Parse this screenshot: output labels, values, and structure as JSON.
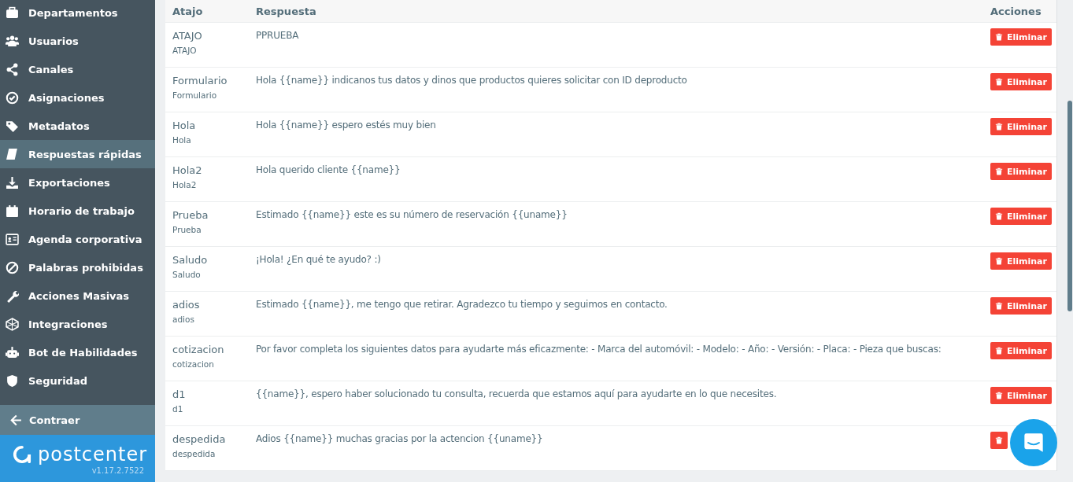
{
  "sidebar": {
    "items": [
      {
        "label": "Departamentos",
        "selected": false
      },
      {
        "label": "Usuarios",
        "selected": false
      },
      {
        "label": "Canales",
        "selected": false
      },
      {
        "label": "Asignaciones",
        "selected": false
      },
      {
        "label": "Metadatos",
        "selected": false
      },
      {
        "label": "Respuestas rápidas",
        "selected": true
      },
      {
        "label": "Exportaciones",
        "selected": false
      },
      {
        "label": "Horario de trabajo",
        "selected": false
      },
      {
        "label": "Agenda corporativa",
        "selected": false
      },
      {
        "label": "Palabras prohibidas",
        "selected": false
      },
      {
        "label": "Acciones Masivas",
        "selected": false
      },
      {
        "label": "Integraciones",
        "selected": false
      },
      {
        "label": "Bot de Habilidades",
        "selected": false
      },
      {
        "label": "Seguridad",
        "selected": false
      }
    ],
    "collapse": "Contraer",
    "logo": "postcenter",
    "version": "v1.17.2.7522"
  },
  "table": {
    "columns": [
      "Atajo",
      "Respuesta",
      "Acciones"
    ],
    "rows": [
      {
        "shortcut": "ATAJO",
        "name": "ATAJO",
        "response": "PPRUEBA",
        "action": "Eliminar"
      },
      {
        "shortcut": "Formulario",
        "name": "Formulario",
        "response": "Hola {{name}} indicanos tus datos y dinos que productos quieres solicitar con ID deproducto",
        "action": "Eliminar"
      },
      {
        "shortcut": "Hola",
        "name": "Hola",
        "response": "Hola {{name}} espero estés muy bien",
        "action": "Eliminar"
      },
      {
        "shortcut": "Hola2",
        "name": "Hola2",
        "response": "Hola querido cliente {{name}}",
        "action": "Eliminar"
      },
      {
        "shortcut": "Prueba",
        "name": "Prueba",
        "response": "Estimado {{name}} este es su número de reservación {{uname}}",
        "action": "Eliminar"
      },
      {
        "shortcut": "Saludo",
        "name": "Saludo",
        "response": "¡Hola! ¿En qué te ayudo? :)",
        "action": "Eliminar"
      },
      {
        "shortcut": "adios",
        "name": "adios",
        "response": "Estimado {{name}}, me tengo que retirar. Agradezco tu tiempo y seguimos en contacto.",
        "action": "Eliminar"
      },
      {
        "shortcut": "cotizacion",
        "name": "cotizacion",
        "response": "Por favor completa los siguientes datos para ayudarte más eficazmente: - Marca del automóvil: - Modelo: - Año: - Versión: - Placa: - Pieza que buscas:",
        "action": "Eliminar"
      },
      {
        "shortcut": "d1",
        "name": "d1",
        "response": "{{name}}, espero haber solucionado tu consulta, recuerda que estamos aquí para ayudarte en lo que necesites.",
        "action": "Eliminar"
      },
      {
        "shortcut": "despedida",
        "name": "despedida",
        "response": "Adios {{name}} muchas gracias por la actencion {{uname}}"
      }
    ]
  }
}
